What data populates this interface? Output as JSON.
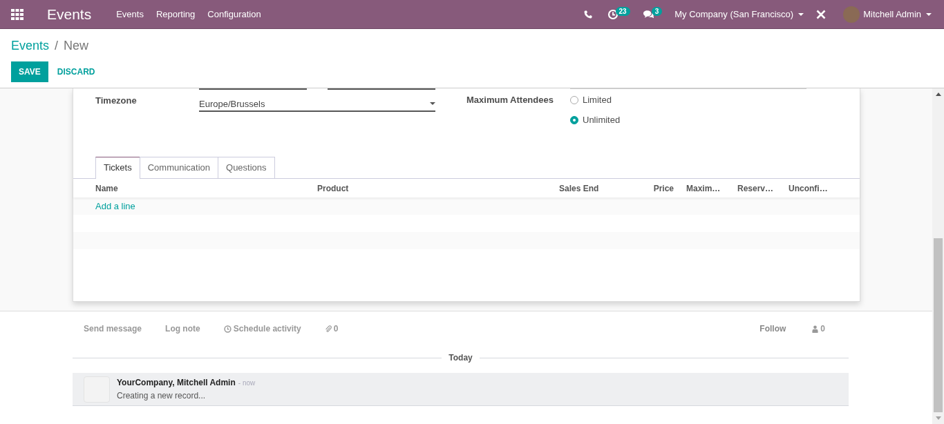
{
  "navbar": {
    "app_name": "Events",
    "menu": [
      "Events",
      "Reporting",
      "Configuration"
    ],
    "activity_count": "23",
    "message_count": "3",
    "company": "My Company (San Francisco)",
    "user": "Mitchell Admin"
  },
  "breadcrumb": {
    "parent": "Events",
    "separator": "/",
    "current": "New"
  },
  "buttons": [
    {
      "label": "SAVE",
      "kind": "primary"
    },
    {
      "label": "DISCARD",
      "kind": "link"
    }
  ],
  "form": {
    "timezone": {
      "label": "Timezone",
      "value": "Europe/Brussels"
    },
    "max_attendees": {
      "label": "Maximum Attendees",
      "options": [
        {
          "label": "Limited",
          "selected": false
        },
        {
          "label": "Unlimited",
          "selected": true
        }
      ]
    }
  },
  "tabs": [
    {
      "label": "Tickets",
      "selected": true
    },
    {
      "label": "Communication",
      "selected": false
    },
    {
      "label": "Questions",
      "selected": false
    }
  ],
  "table": {
    "columns": [
      "Name",
      "Product",
      "Sales End",
      "Price",
      "Maxim…",
      "Reserv…",
      "Unconfi…"
    ],
    "add_line": "Add a line"
  },
  "chatter": {
    "actions": [
      "Send message",
      "Log note",
      "Schedule activity"
    ],
    "attachments": "0",
    "follow": "Follow",
    "followers": "0",
    "date_separator": "Today",
    "message": {
      "author": "YourCompany, Mitchell Admin",
      "time": "- now",
      "body": "Creating a new record..."
    }
  }
}
